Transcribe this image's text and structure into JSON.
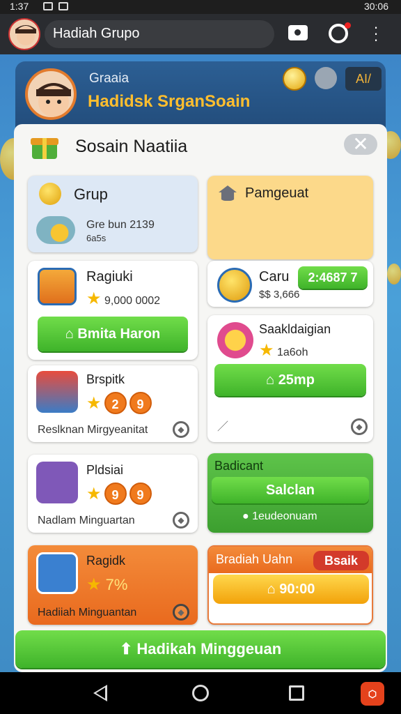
{
  "status_bar": {
    "time": "1:37",
    "battery": "30:06"
  },
  "topbar": {
    "title": "Hadiah Grupo"
  },
  "header": {
    "subtitle": "Graaia",
    "title": "Hadidsk SrganSoain",
    "badge": "AI/"
  },
  "panel": {
    "title": "Sosain Naatiia",
    "group": {
      "title": "Grup",
      "value": "Gre bun 2139",
      "sub": "6a5s"
    },
    "reward": {
      "title": "Pamgeuat"
    },
    "ragiuki": {
      "title": "Ragiuki",
      "value": "9,000 0002",
      "button": "Bmita Haron"
    },
    "caru": {
      "title": "Caru",
      "value": "$$ 3,666",
      "tag": "2:4687 7"
    },
    "brspitk": {
      "title": "Brspitk",
      "badges": [
        "2",
        "9"
      ],
      "footer": "Reslknan Mirgyeanitat"
    },
    "saakl": {
      "title": "Saakldaigian",
      "sub": "1a6oh",
      "button": "25mp"
    },
    "pldsiai": {
      "title": "Pldsiai",
      "badges": [
        "9",
        "9"
      ],
      "footer": "Nadlam Minguartan"
    },
    "badicant": {
      "title": "Badicant",
      "button": "Salclan",
      "footer": "1eudeonuam"
    },
    "ragidk": {
      "title": "Ragidk",
      "value": "7%",
      "footer": "Hadiiah Minguantan"
    },
    "bradiah": {
      "title": "Bradiah Uahn",
      "tag": "Bsaik",
      "value": "90:00"
    }
  },
  "bottom_button": "Hadikah Minggeuan",
  "icons": [
    "camera-icon",
    "record-icon",
    "more-icon",
    "close-icon",
    "back-icon",
    "home-icon",
    "recents-icon"
  ]
}
